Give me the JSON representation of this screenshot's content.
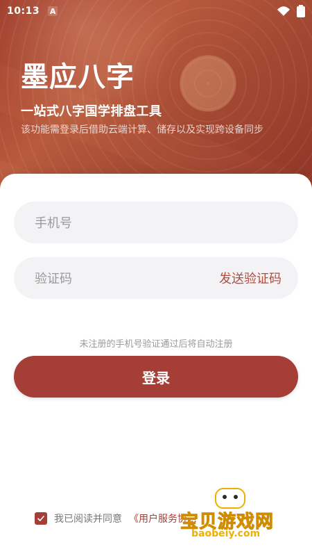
{
  "status": {
    "time": "10:13",
    "notification_letter": "A"
  },
  "header": {
    "app_title": "墨应八字",
    "subtitle": "一站式八字国学排盘工具",
    "note": "该功能需登录后借助云端计算、储存以及实现跨设备同步"
  },
  "form": {
    "phone_placeholder": "手机号",
    "code_placeholder": "验证码",
    "send_code": "发送验证码",
    "auto_register_tip": "未注册的手机号验证通过后将自动注册",
    "login_button": "登录"
  },
  "agreement": {
    "checked": true,
    "prefix": "我已阅读并同意",
    "terms_text": "《用户服务协…"
  },
  "watermark": {
    "brand_text": "宝贝游戏网",
    "domain": "baobeiy.com"
  },
  "colors": {
    "accent": "#a43e36",
    "header_gradient_start": "#9e3b2a",
    "header_gradient_end": "#8f3426",
    "input_bg": "#f3f3f5",
    "placeholder": "#9a9a9a"
  },
  "icons": {
    "wifi": "wifi-icon",
    "battery": "battery-icon",
    "checkbox": "check-icon",
    "notification": "a-notification-icon",
    "watermark_logo": "gamepad-icon"
  }
}
